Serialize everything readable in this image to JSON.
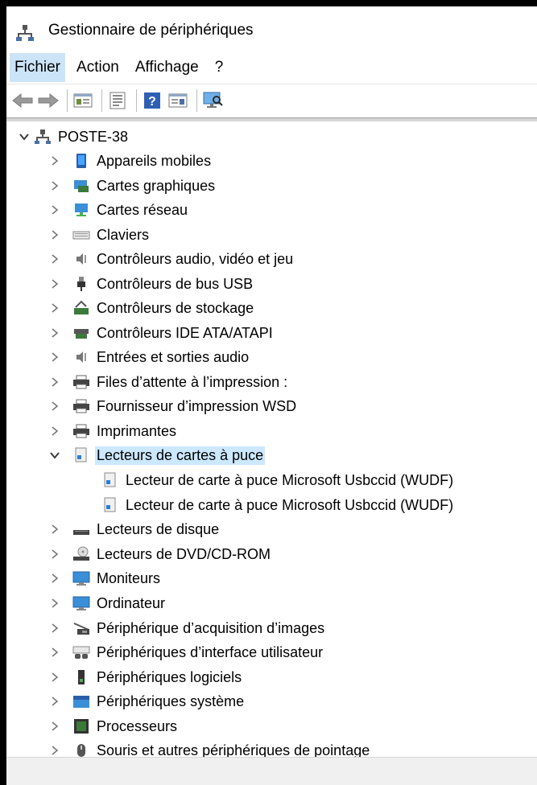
{
  "window": {
    "title": "Gestionnaire de périphériques"
  },
  "menu": {
    "items": [
      "Fichier",
      "Action",
      "Affichage",
      "?"
    ]
  },
  "toolbar": {
    "buttons": [
      "back-arrow-icon",
      "forward-arrow-icon",
      "show-hide-tree-icon",
      "properties-icon",
      "help-icon",
      "update-driver-icon",
      "scan-hardware-icon"
    ]
  },
  "tree": {
    "root": "POSTE-38",
    "categories": [
      "Appareils mobiles",
      "Cartes graphiques",
      "Cartes réseau",
      "Claviers",
      "Contrôleurs audio, vidéo et jeu",
      "Contrôleurs de bus USB",
      "Contrôleurs de stockage",
      "Contrôleurs IDE ATA/ATAPI",
      "Entrées et sorties audio",
      "Files d’attente à l’impression :",
      "Fournisseur d’impression WSD",
      "Imprimantes",
      "Lecteurs de cartes à puce",
      "Lecteur de carte à puce Microsoft Usbccid (WUDF)",
      "Lecteur de carte à puce Microsoft Usbccid (WUDF)",
      "Lecteurs de disque",
      "Lecteurs de DVD/CD-ROM",
      "Moniteurs",
      "Ordinateur",
      "Périphérique d’acquisition d’images",
      "Périphériques d’interface utilisateur",
      "Périphériques logiciels",
      "Périphériques système",
      "Processeurs",
      "Souris et autres périphériques de pointage"
    ]
  },
  "colors": {
    "selection": "#cce8ff",
    "menu_active": "#cce4f7",
    "chevron": "#5a5a5a"
  }
}
